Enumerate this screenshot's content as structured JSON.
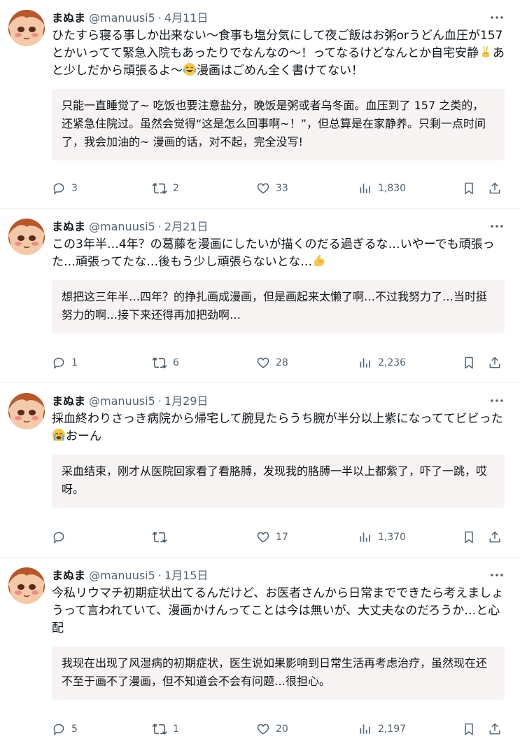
{
  "tweets": [
    {
      "name": "まぬま",
      "handle": "@manuusi5",
      "separator": "·",
      "date": "4月11日",
      "text_parts": [
        "ひたすら寝る事しか出来ない〜食事も塩分気にして夜ご飯はお粥orうどん血圧が157とかいってて緊急入院もあったりでなんなの〜！ってなるけどなんとか自宅安静",
        "あと少しだから頑張るよ〜",
        "漫画はごめん全く書けてない！"
      ],
      "emojis": [
        "victory-hand",
        "joy-face"
      ],
      "translation": "只能一直睡觉了~ 吃饭也要注意盐分，晚饭是粥或者乌冬面。血压到了 157 之类的，还紧急住院过。虽然会觉得“这是怎么回事啊~！”，但总算是在家静养。只剩一点时间了，我会加油的~ 漫画的话，对不起，完全没写!",
      "replies": "3",
      "retweets": "2",
      "likes": "33",
      "views": "1,830"
    },
    {
      "name": "まぬま",
      "handle": "@manuusi5",
      "separator": "·",
      "date": "2月21日",
      "text_parts": [
        "この3年半…4年？の葛藤を漫画にしたいが描くのだる過ぎるな…いやーでも頑張った…頑張ってたな…後もう少し頑張らないとな…",
        "",
        ""
      ],
      "emojis": [
        "flexed-biceps"
      ],
      "translation": "想把这三年半…四年？的挣扎画成漫画，但是画起来太懒了啊…不过我努力了…当时挺努力的啊…接下来还得再加把劲啊…",
      "replies": "1",
      "retweets": "6",
      "likes": "28",
      "views": "2,236"
    },
    {
      "name": "まぬま",
      "handle": "@manuusi5",
      "separator": "·",
      "date": "1月29日",
      "text_parts": [
        "採血終わりさっき病院から帰宅して腕見たらうち腕が半分以上紫になっててビビった",
        "おーん",
        ""
      ],
      "emojis": [
        "crying-face"
      ],
      "translation": "采血结束，刚才从医院回家看了看胳膊，发现我的胳膊一半以上都紫了，吓了一跳，哎呀。",
      "replies": "",
      "retweets": "",
      "likes": "17",
      "views": "1,370"
    },
    {
      "name": "まぬま",
      "handle": "@manuusi5",
      "separator": "·",
      "date": "1月15日",
      "text_parts": [
        "今私リウマチ初期症状出てるんだけど、お医者さんから日常までできたら考えましょうって言われていて、漫画かけんってことは今は無いが、大丈夫なのだろうか…と心配",
        "",
        ""
      ],
      "emojis": [],
      "translation": "我现在出现了风湿病的初期症状，医生说如果影响到日常生活再考虑治疗，虽然现在还不至于画不了漫画，但不知道会不会有问题…很担心。",
      "replies": "5",
      "retweets": "1",
      "likes": "20",
      "views": "2,197"
    }
  ],
  "icons": [
    "avatar",
    "more-icon",
    "reply-icon",
    "retweet-icon",
    "like-icon",
    "views-icon",
    "bookmark-icon",
    "share-icon"
  ],
  "colors": {
    "text": "#0f1419",
    "secondary": "#536471",
    "translation_bg": "#f7f3f3",
    "divider": "#eff3f4"
  }
}
